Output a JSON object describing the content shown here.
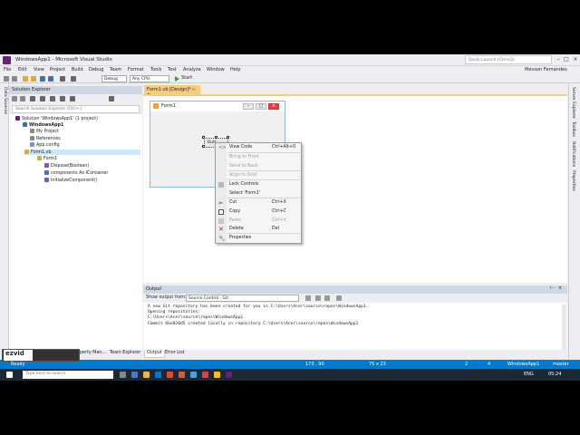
{
  "window": {
    "title": "WindowsApp1 - Microsoft Visual Studio",
    "quick_launch_placeholder": "Quick Launch (Ctrl+Q)",
    "user": "Mevson Fernandes"
  },
  "menu": [
    "File",
    "Edit",
    "View",
    "Project",
    "Build",
    "Debug",
    "Team",
    "Format",
    "Tools",
    "Test",
    "Analyze",
    "Window",
    "Help"
  ],
  "toolbar": {
    "config": "Debug",
    "platform": "Any CPU",
    "start": "Start"
  },
  "left_strip": {
    "items": [
      "Data Sources"
    ]
  },
  "right_strip": {
    "items": [
      "Server Explorer",
      "Toolbox",
      "Notifications",
      "Properties"
    ]
  },
  "solution_explorer": {
    "title": "Solution Explorer",
    "search_placeholder": "Search Solution Explorer (Ctrl+;)",
    "tree": [
      {
        "label": "Solution 'WindowsApp1' (1 project)",
        "bold": false
      },
      {
        "label": "WindowsApp1",
        "bold": true
      },
      {
        "label": "My Project",
        "bold": false
      },
      {
        "label": "References",
        "bold": false
      },
      {
        "label": "App.config",
        "bold": false
      },
      {
        "label": "Form1.vb",
        "bold": false
      },
      {
        "label": "Form1",
        "bold": false
      },
      {
        "label": "Dispose(Boolean)",
        "bold": false
      },
      {
        "label": "components As IContainer",
        "bold": false
      },
      {
        "label": "InitializeComponent()",
        "bold": false
      }
    ],
    "tabs": [
      "perty Man...",
      "Team Explorer"
    ]
  },
  "document": {
    "tab_label": "Form1.vb [Design]*"
  },
  "form": {
    "title": "Form1",
    "button_label": "Butt"
  },
  "context_menu": [
    {
      "label": "View Code",
      "shortcut": "Ctrl+Alt+0",
      "disabled": false,
      "icon": "code-icon"
    },
    {
      "label": "Bring to Front",
      "shortcut": "",
      "disabled": true,
      "icon": ""
    },
    {
      "label": "Send to Back",
      "shortcut": "",
      "disabled": true,
      "icon": ""
    },
    {
      "label": "Align to Grid",
      "shortcut": "",
      "disabled": true,
      "icon": ""
    },
    {
      "label": "Lock Controls",
      "shortcut": "",
      "disabled": false,
      "icon": "lock-icon"
    },
    {
      "label": "Select 'Form1'",
      "shortcut": "",
      "disabled": false,
      "icon": ""
    },
    {
      "label": "Cut",
      "shortcut": "Ctrl+X",
      "disabled": false,
      "icon": "scissors-icon"
    },
    {
      "label": "Copy",
      "shortcut": "Ctrl+C",
      "disabled": false,
      "icon": "copy-icon"
    },
    {
      "label": "Paste",
      "shortcut": "Ctrl+V",
      "disabled": true,
      "icon": "paste-icon"
    },
    {
      "label": "Delete",
      "shortcut": "Del",
      "disabled": false,
      "icon": "delete-icon"
    },
    {
      "label": "Properties",
      "shortcut": "",
      "disabled": false,
      "icon": "wrench-icon"
    }
  ],
  "output": {
    "title": "Output",
    "show_from_label": "Show output from:",
    "source": "Source Control - Git",
    "lines": [
      "A new Git repository has been created for you in C:\\Users\\Acer\\source\\repos\\WindowsApp1.",
      "Opening repositories:",
      "C:\\Users\\Acer\\source\\repos\\WindowsApp1",
      "Commit 6be020d5 created locally in repository C:\\Users\\Acer\\source\\repos\\WindowsApp1"
    ],
    "tabs": [
      "Output",
      "Error List"
    ]
  },
  "statusbar": {
    "left": "Ready",
    "position": "173 , 90",
    "size": "75 x 23",
    "up_count": "2",
    "edit_count": "4",
    "repo": "WindowsApp1",
    "branch": "master"
  },
  "taskbar": {
    "search_placeholder": "Type here to search",
    "language": "ENG",
    "time": "05:24"
  },
  "watermark": {
    "brand": "ezvid"
  },
  "colors": {
    "accent": "#007acc",
    "tab_active": "#f5cc84",
    "vs_purple": "#68217a"
  }
}
